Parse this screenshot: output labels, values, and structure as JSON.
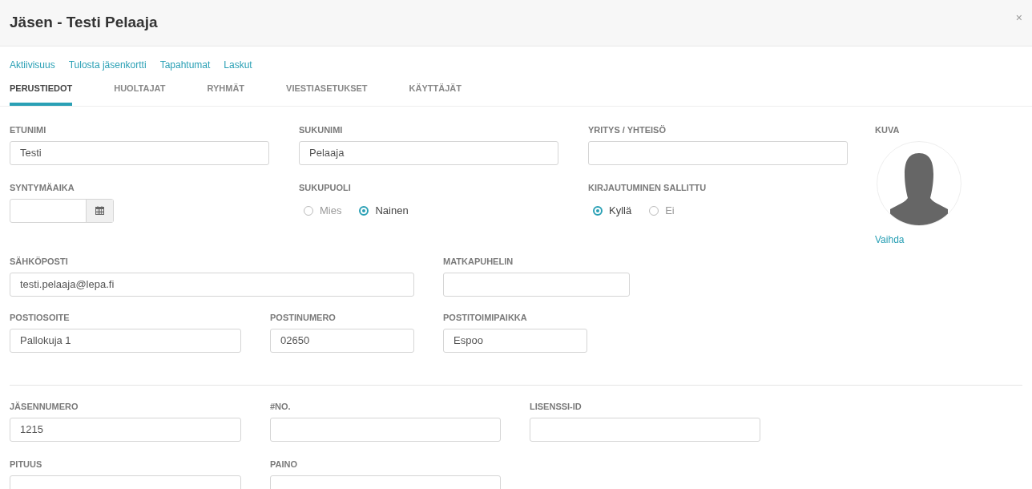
{
  "dialog": {
    "title": "Jäsen - Testi Pelaaja",
    "close": "×"
  },
  "links": [
    "Aktiivisuus",
    "Tulosta jäsenkortti",
    "Tapahtumat",
    "Laskut"
  ],
  "tabs": [
    {
      "label": "PERUSTIEDOT",
      "selected": true
    },
    {
      "label": "HUOLTAJAT",
      "selected": false
    },
    {
      "label": "RYHMÄT",
      "selected": false
    },
    {
      "label": "VIESTIASETUKSET",
      "selected": false
    },
    {
      "label": "KÄYTTÄJÄT",
      "selected": false
    }
  ],
  "sections": [
    {
      "rows": [
        {
          "fields": [
            {
              "kind": "text",
              "label": "ETUNIMI",
              "value": "Testi"
            },
            {
              "kind": "text",
              "label": "SUKUNIMI",
              "value": "Pelaaja"
            },
            {
              "kind": "text",
              "label": "YRITYS / YHTEISÖ"
            }
          ]
        },
        {
          "fields": [
            {
              "kind": "date",
              "label": "SYNTYMÄAIKA"
            },
            {
              "kind": "radio",
              "label": "SUKUPUOLI",
              "options": [
                {
                  "label": "Mies",
                  "selected": false
                },
                {
                  "label": "Nainen",
                  "selected": true
                }
              ]
            },
            {
              "kind": "radio",
              "label": "KIRJAUTUMINEN SALLITTU",
              "options": [
                {
                  "label": "Kyllä",
                  "selected": true
                },
                {
                  "label": "Ei",
                  "selected": false
                }
              ]
            }
          ]
        }
      ]
    },
    {
      "rows": [
        {
          "fields": [
            {
              "kind": "text",
              "label": "SÄHKÖPOSTI",
              "value": "testi.pelaaja@lepa.fi"
            },
            {
              "kind": "text",
              "label": "MATKAPUHELIN"
            }
          ]
        },
        {
          "fields": [
            {
              "kind": "text",
              "label": "POSTIOSOITE",
              "value": "Pallokuja 1"
            },
            {
              "kind": "text",
              "label": "POSTINUMERO",
              "value": "02650"
            },
            {
              "kind": "text",
              "label": "POSTITOIMIPAIKKA",
              "value": "Espoo"
            }
          ]
        }
      ]
    },
    {
      "rows": [
        {
          "fields": [
            {
              "kind": "text",
              "label": "JÄSENNUMERO",
              "value": "1215"
            },
            {
              "kind": "text",
              "label": "#NO."
            },
            {
              "kind": "text",
              "label": "LISENSSI-ID"
            }
          ]
        },
        {
          "fields": [
            {
              "kind": "text",
              "label": "PITUUS"
            },
            {
              "kind": "text",
              "label": "PAINO"
            }
          ]
        }
      ]
    }
  ],
  "photo": {
    "label": "KUVA",
    "link": "Vaihda"
  }
}
